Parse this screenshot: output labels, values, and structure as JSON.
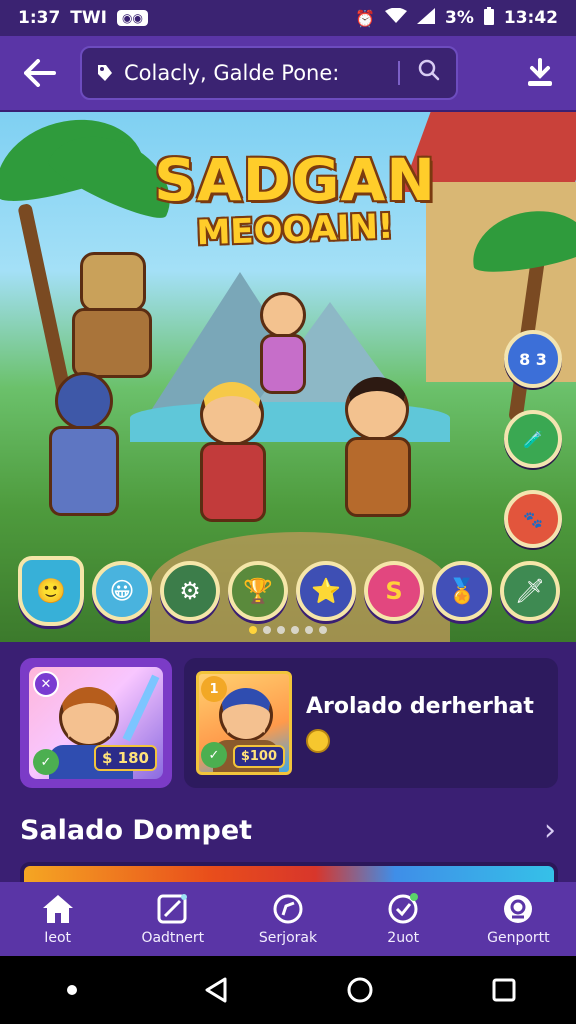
{
  "status_bar": {
    "time": "1:37",
    "carrier": "TWI",
    "chip": "◉◉",
    "battery_text": "3%",
    "clock_right": "13:42"
  },
  "header": {
    "search_text": "Colacly, Galde Pone:"
  },
  "hero": {
    "title": "SADGAN",
    "subtitle": "MEOOAIN!",
    "side_badges": [
      "8 3",
      "",
      ""
    ],
    "carousel_count": 6,
    "carousel_active": 0
  },
  "cards": {
    "left": {
      "price": "$ 180"
    },
    "right": {
      "title": "Arolado derherhat",
      "price": "$100"
    }
  },
  "section": {
    "title": "Salado Dompet"
  },
  "bottom_nav": [
    {
      "label": "Ieot",
      "icon": "home-icon"
    },
    {
      "label": "Oadtnert",
      "icon": "edit-icon"
    },
    {
      "label": "Serjorak",
      "icon": "compass-icon"
    },
    {
      "label": "2uot",
      "icon": "check-icon"
    },
    {
      "label": "Genportt",
      "icon": "support-icon"
    }
  ],
  "colors": {
    "primary": "#5a35a6",
    "background": "#3a1f73",
    "accent": "#ffcd2a"
  }
}
